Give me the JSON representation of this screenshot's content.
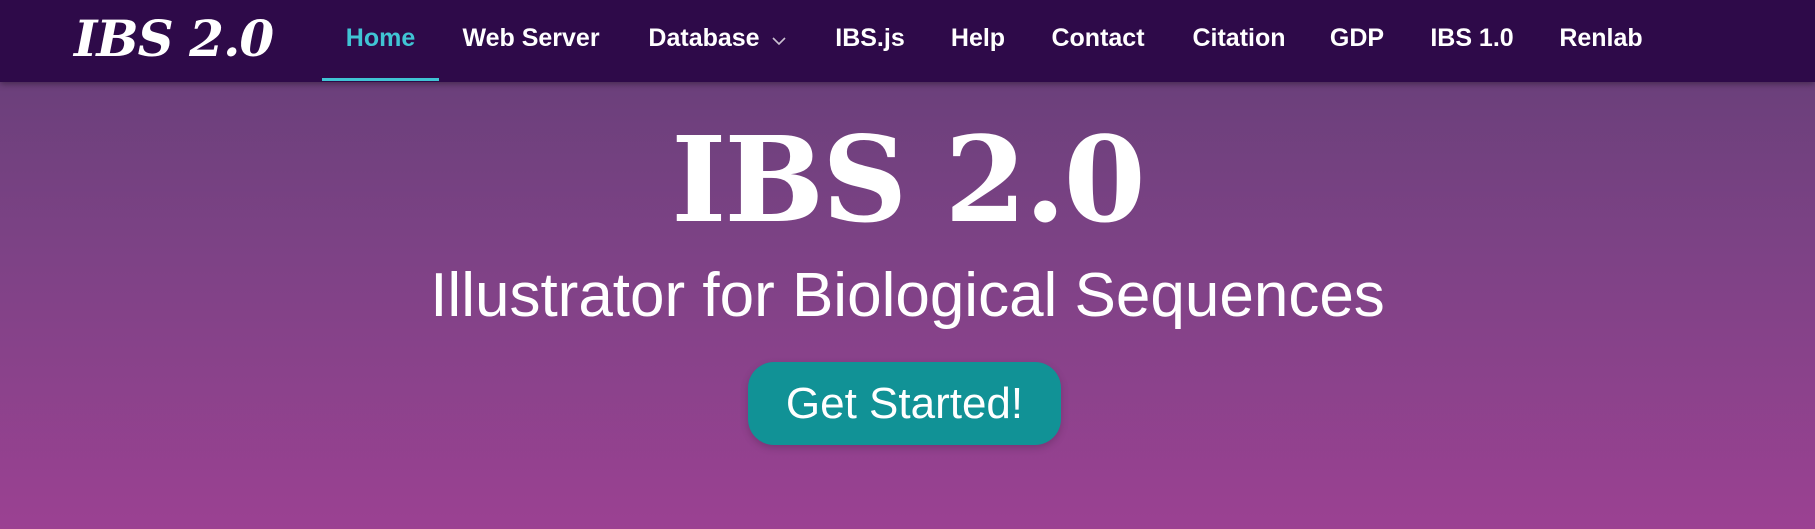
{
  "brand": "IBS 2.0",
  "nav": {
    "items": [
      {
        "label": "Home",
        "active": true
      },
      {
        "label": "Web Server"
      },
      {
        "label": "Database",
        "has_dropdown": true
      },
      {
        "label": "IBS.js"
      },
      {
        "label": "Help"
      },
      {
        "label": "Contact"
      },
      {
        "label": "Citation"
      },
      {
        "label": "GDP"
      },
      {
        "label": "IBS 1.0"
      },
      {
        "label": "Renlab"
      }
    ],
    "dropdown_icon": "chevron-down-icon"
  },
  "hero": {
    "title": "IBS 2.0",
    "subtitle": "Illustrator for Biological Sequences",
    "cta_label": "Get Started!"
  },
  "colors": {
    "navbar_bg": "#2e0a49",
    "active_accent": "#40c4d4",
    "hero_gradient_top": "#6b407b",
    "hero_gradient_bottom": "#9b4192",
    "cta_bg": "#119296"
  }
}
